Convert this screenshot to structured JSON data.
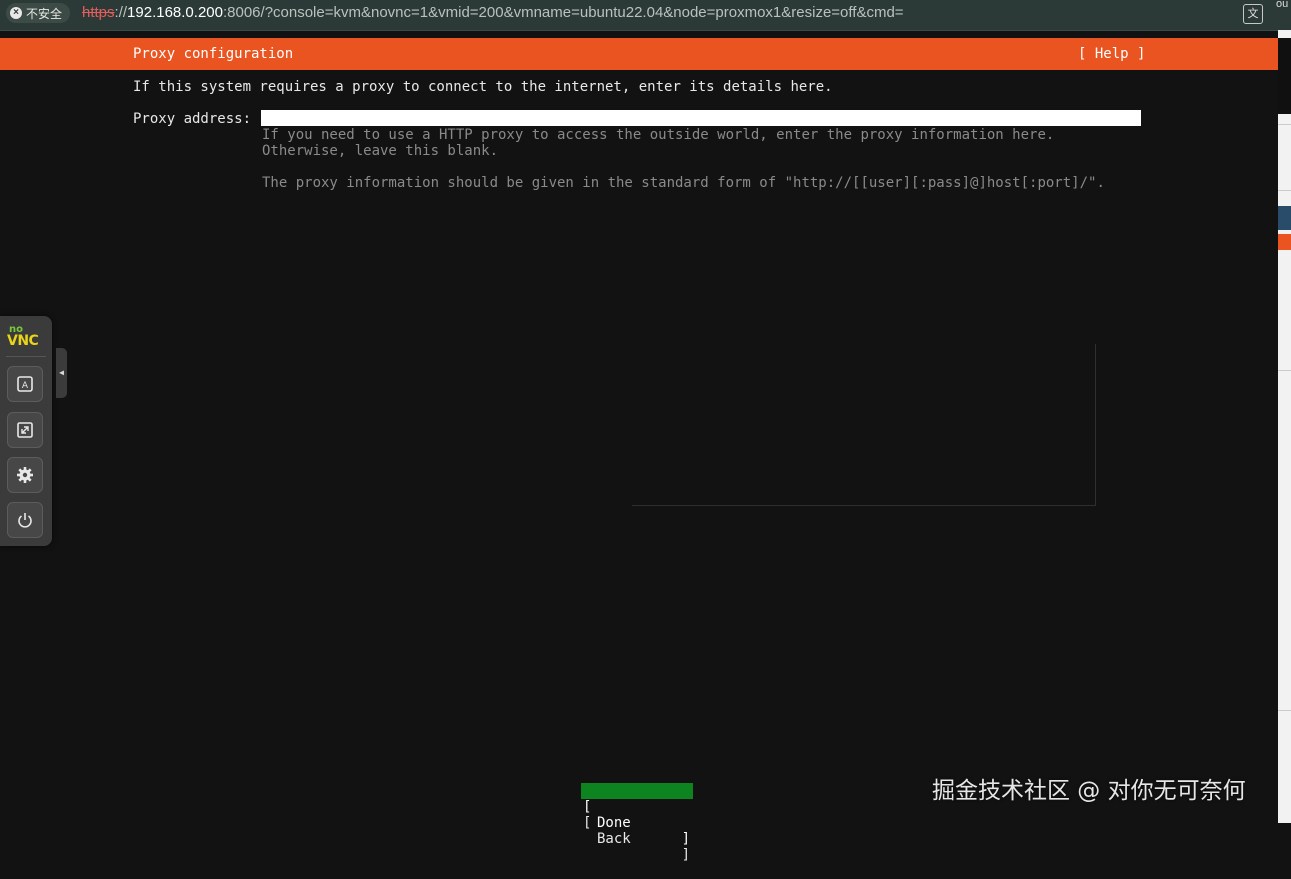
{
  "browser": {
    "security_label": "不安全",
    "url_scheme": "https",
    "url_sep": "://",
    "url_host": "192.168.0.200",
    "url_rest": ":8006/?console=kvm&novnc=1&vmid=200&vmname=ubuntu22.04&node=proxmox1&resize=off&cmd="
  },
  "installer": {
    "title": "Proxy configuration",
    "help_label": "[ Help ]",
    "intro": "If this system requires a proxy to connect to the internet, enter its details here.",
    "proxy_label": "Proxy address:",
    "proxy_value": "",
    "help_text_1": "If you need to use a HTTP proxy to access the outside world, enter the proxy information here. Otherwise, leave this blank.",
    "help_text_2": "The proxy information should be given in the standard form of \"http://[[user][:pass]@]host[:port]/\".",
    "buttons": {
      "done": "Done",
      "back": "Back",
      "bracket_left": "[",
      "bracket_right": "]"
    },
    "colors": {
      "header": "#e95420",
      "focused_button": "#0e8420",
      "background": "#121212"
    }
  },
  "novnc": {
    "logo_no": "no",
    "logo_vnc": "VNC",
    "icons": [
      "keyboard-icon",
      "fullscreen-icon",
      "settings-icon",
      "power-icon"
    ]
  },
  "watermark": "掘金技术社区 @ 对你无可奈何"
}
